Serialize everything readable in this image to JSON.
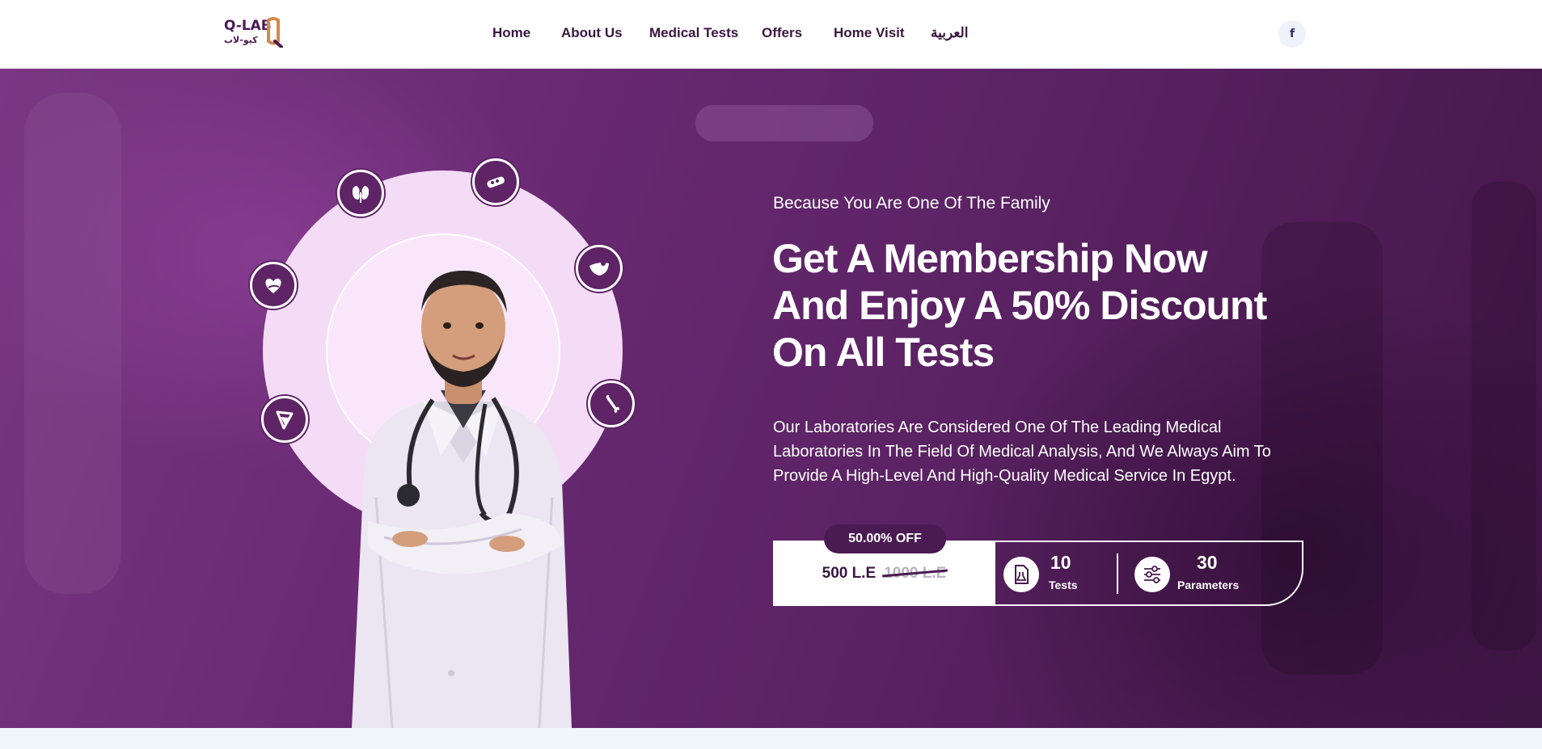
{
  "header": {
    "logo_text": "Q-LAB",
    "logo_arabic": "كيو-لاب",
    "nav": [
      {
        "label": "Home"
      },
      {
        "label": "About Us"
      },
      {
        "label": "Medical Tests"
      },
      {
        "label": "Offers"
      },
      {
        "label": "Home Visit"
      },
      {
        "label": "العربية"
      }
    ],
    "social_icon": "facebook-icon",
    "social_glyph": "f"
  },
  "hero": {
    "tagline": "Because You Are One Of The Family",
    "headline": "Get A Membership Now And Enjoy A 50% Discount On All Tests",
    "description": "Our Laboratories Are Considered One Of The Leading Medical Laboratories In The Field Of Medical Analysis, And We Always Aim To Provide A High-Level And High-Quality Medical Service In Egypt.",
    "orbit_icons": [
      "kidney-icon",
      "thermometer-icon",
      "liver-icon",
      "bone-icon",
      "flask-icon",
      "heart-icon"
    ]
  },
  "offer": {
    "discount_badge": "50.00% OFF",
    "price_now": "500 L.E",
    "price_old": "1000 L.E",
    "tests": {
      "value": "10",
      "label": "Tests",
      "icon": "test-report-icon"
    },
    "parameters": {
      "value": "30",
      "label": "Parameters",
      "icon": "sliders-icon"
    }
  },
  "colors": {
    "brand_purple": "#4a1a52",
    "hero_purple": "#6a2a74",
    "circle_pink": "#f4dcf7",
    "logo_orange": "#d3894a"
  }
}
